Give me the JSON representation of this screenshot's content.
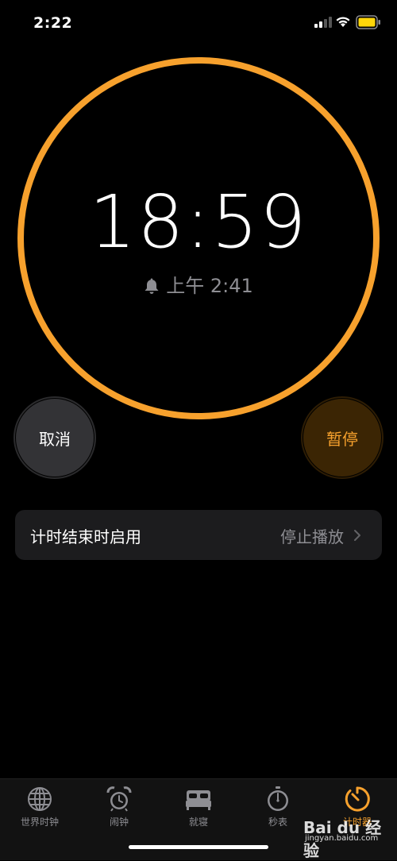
{
  "status_bar": {
    "time": "2:22"
  },
  "timer": {
    "remaining": "18:59",
    "alarm_time": "上午 2:41",
    "ring_color": "#f7a12d"
  },
  "controls": {
    "cancel_label": "取消",
    "pause_label": "暂停"
  },
  "settings": {
    "when_timer_ends_label": "计时结束时启用",
    "when_timer_ends_value": "停止播放"
  },
  "tab_bar": {
    "tabs": [
      {
        "label": "世界时钟",
        "icon": "globe-icon",
        "active": false
      },
      {
        "label": "闹钟",
        "icon": "alarm-clock-icon",
        "active": false
      },
      {
        "label": "就寝",
        "icon": "bed-icon",
        "active": false
      },
      {
        "label": "秒表",
        "icon": "stopwatch-icon",
        "active": false
      },
      {
        "label": "计时器",
        "icon": "timer-icon",
        "active": true
      }
    ]
  },
  "watermark": {
    "brand": "Bai du 经验",
    "url": "jingyan.baidu.com"
  },
  "colors": {
    "accent": "#f7a12d",
    "background": "#000000",
    "secondary_text": "#8e8e93"
  }
}
